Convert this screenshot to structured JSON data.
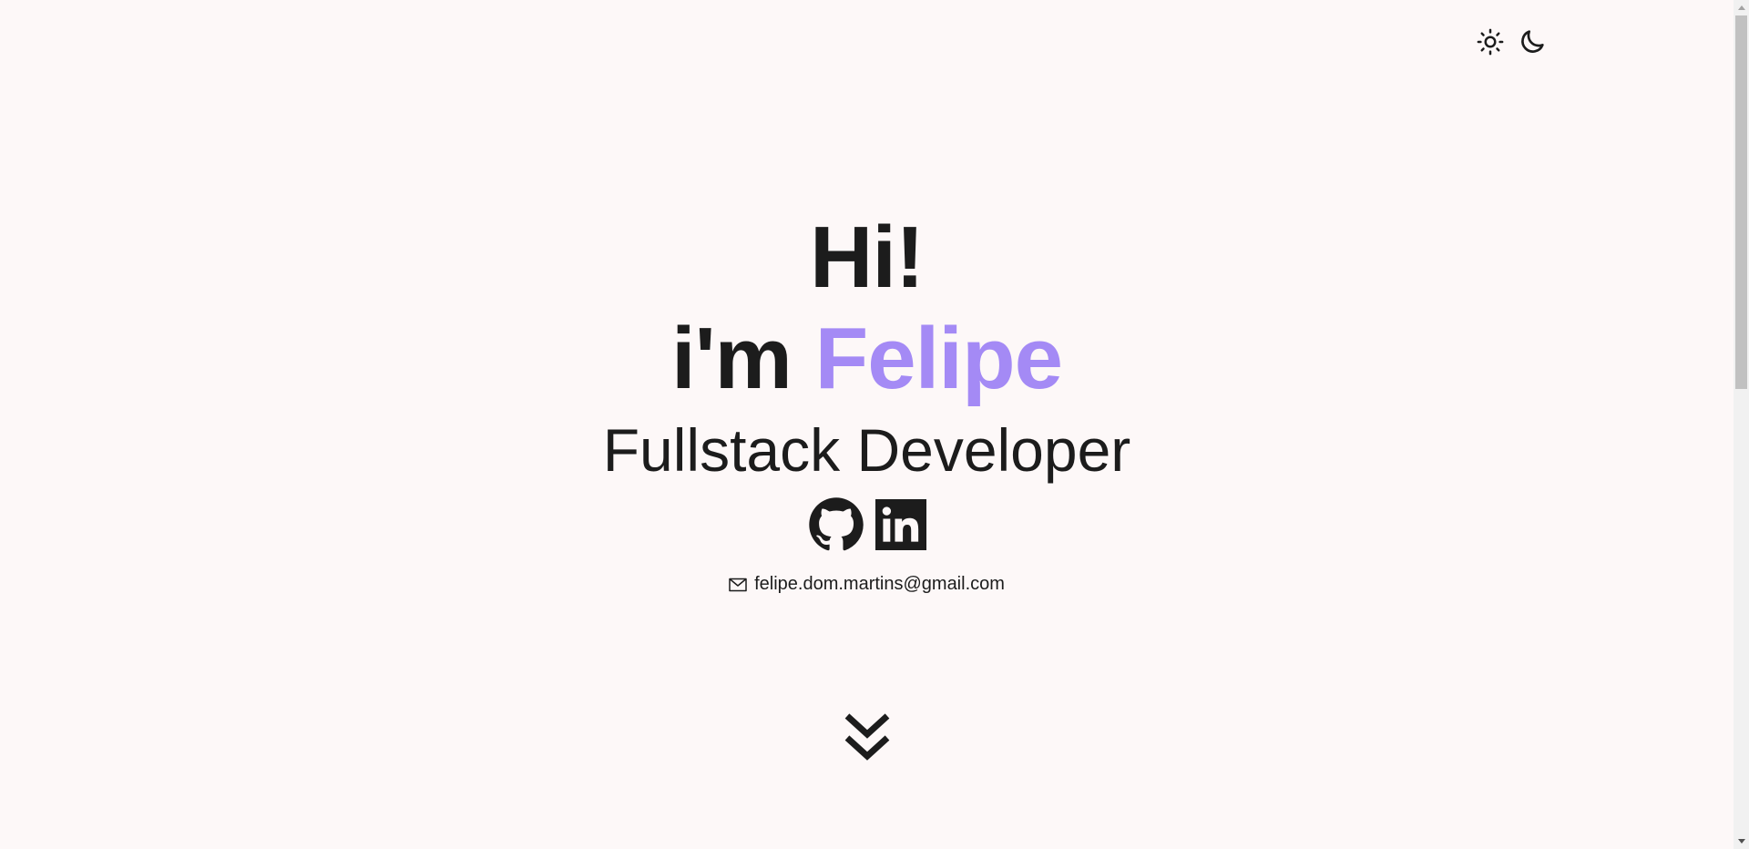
{
  "header": {
    "theme_toggle": {
      "light_icon": "sun-icon",
      "dark_icon": "moon-icon"
    }
  },
  "hero": {
    "greeting": "Hi!",
    "intro_prefix": "i'm ",
    "name": "Felipe",
    "role": "Fullstack Developer",
    "socials": [
      {
        "name": "GitHub",
        "icon": "github-icon"
      },
      {
        "name": "LinkedIn",
        "icon": "linkedin-icon"
      }
    ],
    "email_icon": "mail-icon",
    "email": "felipe.dom.martins@gmail.com",
    "scroll_icon": "chevrons-down-icon"
  },
  "colors": {
    "background": "#fdf8f8",
    "text": "#1c1c1c",
    "accent": "#a48af5"
  }
}
